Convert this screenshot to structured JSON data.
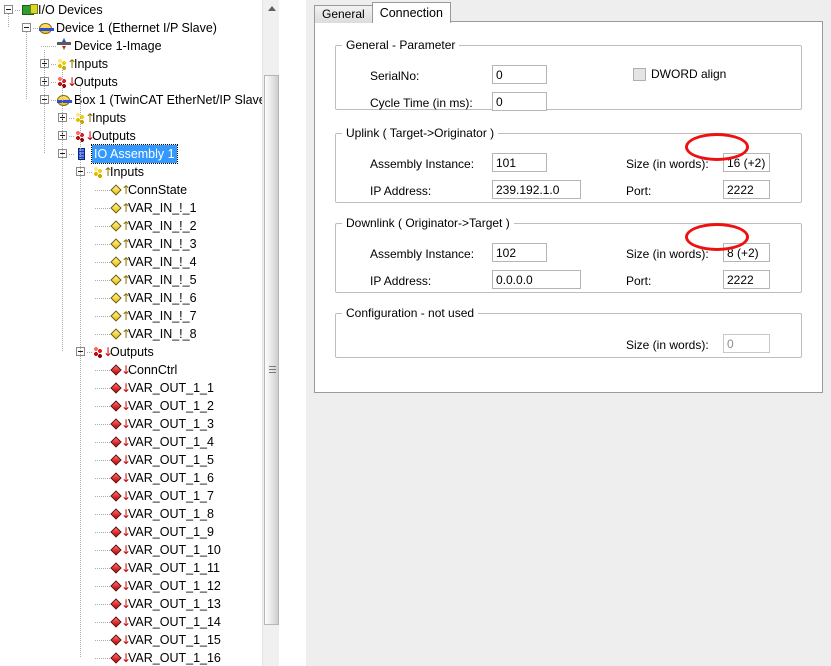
{
  "tree": {
    "nodes": [
      {
        "label": "I/O Devices",
        "depth": 0,
        "icon": "io-devices-icon",
        "expander": "minus",
        "selected": false
      },
      {
        "label": "Device 1 (Ethernet I/P Slave)",
        "depth": 1,
        "icon": "device-icon",
        "expander": "minus",
        "selected": false
      },
      {
        "label": "Device 1-Image",
        "depth": 2,
        "icon": "image-icon",
        "expander": "none",
        "selected": false
      },
      {
        "label": "Inputs",
        "depth": 2,
        "icon": "inputs-group-icon",
        "expander": "plus",
        "selected": false
      },
      {
        "label": "Outputs",
        "depth": 2,
        "icon": "outputs-group-icon",
        "expander": "plus",
        "selected": false
      },
      {
        "label": "Box 1 (TwinCAT EtherNet/IP Slave)",
        "depth": 2,
        "icon": "device-icon",
        "expander": "minus",
        "selected": false
      },
      {
        "label": "Inputs",
        "depth": 3,
        "icon": "inputs-group-icon",
        "expander": "plus",
        "selected": false
      },
      {
        "label": "Outputs",
        "depth": 3,
        "icon": "outputs-group-icon",
        "expander": "plus",
        "selected": false
      },
      {
        "label": "IO Assembly 1",
        "depth": 3,
        "icon": "assembly-icon",
        "expander": "minus",
        "selected": true
      },
      {
        "label": "Inputs",
        "depth": 4,
        "icon": "inputs-group-icon",
        "expander": "minus",
        "selected": false
      },
      {
        "label": "ConnState",
        "depth": 5,
        "icon": "input-var-icon",
        "expander": "none",
        "selected": false
      },
      {
        "label": "VAR_IN_!_1",
        "depth": 5,
        "icon": "input-var-icon",
        "expander": "none",
        "selected": false
      },
      {
        "label": "VAR_IN_!_2",
        "depth": 5,
        "icon": "input-var-icon",
        "expander": "none",
        "selected": false
      },
      {
        "label": "VAR_IN_!_3",
        "depth": 5,
        "icon": "input-var-icon",
        "expander": "none",
        "selected": false
      },
      {
        "label": "VAR_IN_!_4",
        "depth": 5,
        "icon": "input-var-icon",
        "expander": "none",
        "selected": false
      },
      {
        "label": "VAR_IN_!_5",
        "depth": 5,
        "icon": "input-var-icon",
        "expander": "none",
        "selected": false
      },
      {
        "label": "VAR_IN_!_6",
        "depth": 5,
        "icon": "input-var-icon",
        "expander": "none",
        "selected": false
      },
      {
        "label": "VAR_IN_!_7",
        "depth": 5,
        "icon": "input-var-icon",
        "expander": "none",
        "selected": false
      },
      {
        "label": "VAR_IN_!_8",
        "depth": 5,
        "icon": "input-var-icon",
        "expander": "none",
        "selected": false
      },
      {
        "label": "Outputs",
        "depth": 4,
        "icon": "outputs-group-icon",
        "expander": "minus",
        "selected": false
      },
      {
        "label": "ConnCtrl",
        "depth": 5,
        "icon": "output-var-icon",
        "expander": "none",
        "selected": false
      },
      {
        "label": "VAR_OUT_1_1",
        "depth": 5,
        "icon": "output-var-icon",
        "expander": "none",
        "selected": false
      },
      {
        "label": "VAR_OUT_1_2",
        "depth": 5,
        "icon": "output-var-icon",
        "expander": "none",
        "selected": false
      },
      {
        "label": "VAR_OUT_1_3",
        "depth": 5,
        "icon": "output-var-icon",
        "expander": "none",
        "selected": false
      },
      {
        "label": "VAR_OUT_1_4",
        "depth": 5,
        "icon": "output-var-icon",
        "expander": "none",
        "selected": false
      },
      {
        "label": "VAR_OUT_1_5",
        "depth": 5,
        "icon": "output-var-icon",
        "expander": "none",
        "selected": false
      },
      {
        "label": "VAR_OUT_1_6",
        "depth": 5,
        "icon": "output-var-icon",
        "expander": "none",
        "selected": false
      },
      {
        "label": "VAR_OUT_1_7",
        "depth": 5,
        "icon": "output-var-icon",
        "expander": "none",
        "selected": false
      },
      {
        "label": "VAR_OUT_1_8",
        "depth": 5,
        "icon": "output-var-icon",
        "expander": "none",
        "selected": false
      },
      {
        "label": "VAR_OUT_1_9",
        "depth": 5,
        "icon": "output-var-icon",
        "expander": "none",
        "selected": false
      },
      {
        "label": "VAR_OUT_1_10",
        "depth": 5,
        "icon": "output-var-icon",
        "expander": "none",
        "selected": false
      },
      {
        "label": "VAR_OUT_1_11",
        "depth": 5,
        "icon": "output-var-icon",
        "expander": "none",
        "selected": false
      },
      {
        "label": "VAR_OUT_1_12",
        "depth": 5,
        "icon": "output-var-icon",
        "expander": "none",
        "selected": false
      },
      {
        "label": "VAR_OUT_1_13",
        "depth": 5,
        "icon": "output-var-icon",
        "expander": "none",
        "selected": false
      },
      {
        "label": "VAR_OUT_1_14",
        "depth": 5,
        "icon": "output-var-icon",
        "expander": "none",
        "selected": false
      },
      {
        "label": "VAR_OUT_1_15",
        "depth": 5,
        "icon": "output-var-icon",
        "expander": "none",
        "selected": false
      },
      {
        "label": "VAR_OUT_1_16",
        "depth": 5,
        "icon": "output-var-icon",
        "expander": "none",
        "selected": false
      }
    ]
  },
  "tabs": [
    {
      "label": "General",
      "active": false
    },
    {
      "label": "Connection",
      "active": true
    }
  ],
  "general_parameter": {
    "legend": "General - Parameter",
    "serialno_label": "SerialNo:",
    "serialno_value": "0",
    "cycletime_label": "Cycle Time (in ms):",
    "cycletime_value": "0",
    "dword_align_label": "DWORD align",
    "dword_align_checked": false
  },
  "uplink": {
    "legend": "Uplink ( Target->Originator )",
    "assembly_label": "Assembly Instance:",
    "assembly_value": "101",
    "ip_label": "IP Address:",
    "ip_value": "239.192.1.0",
    "size_label": "Size (in words):",
    "size_value": "16 (+2)",
    "port_label": "Port:",
    "port_value": "2222",
    "size_highlighted": true
  },
  "downlink": {
    "legend": "Downlink ( Originator->Target )",
    "assembly_label": "Assembly Instance:",
    "assembly_value": "102",
    "ip_label": "IP Address:",
    "ip_value": "0.0.0.0",
    "size_label": "Size (in words):",
    "size_value": "8 (+2)",
    "port_label": "Port:",
    "port_value": "2222",
    "size_highlighted": true
  },
  "configuration": {
    "legend": "Configuration - not used",
    "size_label": "Size (in words):",
    "size_value": "0",
    "size_disabled": true
  },
  "colors": {
    "selection": "#3399ff",
    "annotation": "#ee1111",
    "panel_bg": "#eeeeee",
    "group_border": "#bdbdbd"
  }
}
